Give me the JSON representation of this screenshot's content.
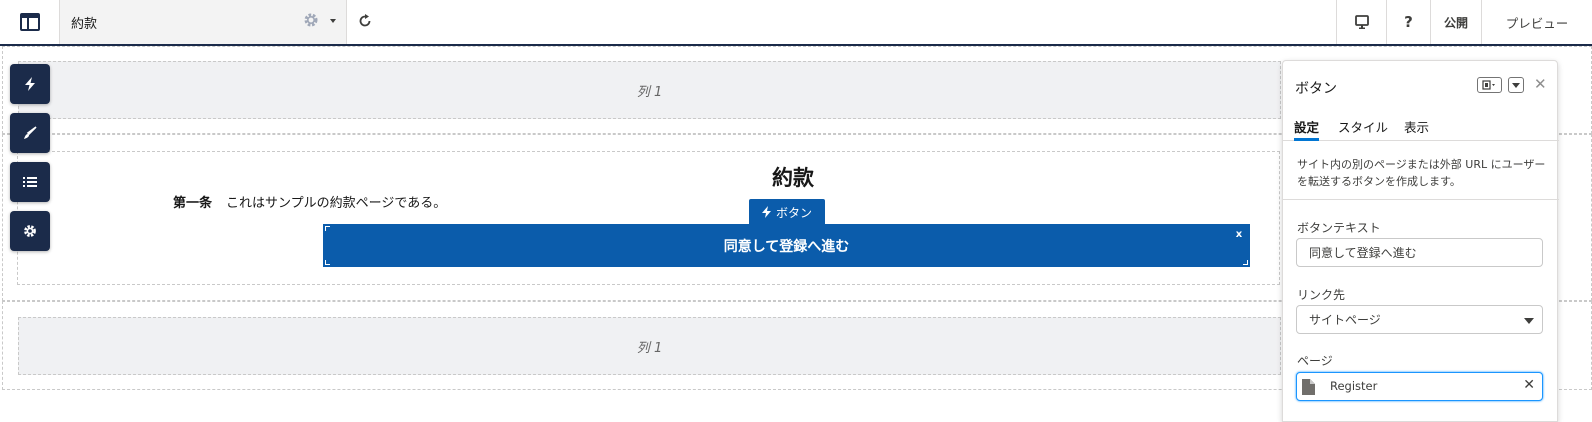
{
  "header": {
    "page_name": "約款",
    "publish_label": "公開",
    "preview_label": "プレビュー",
    "help_label": "?"
  },
  "canvas": {
    "column_label_top": "列",
    "column_number_top": "1",
    "column_label_bottom": "列",
    "column_number_bottom": "1",
    "title": "約款",
    "article_label": "第一条",
    "article_text": "これはサンプルの約款ページである。",
    "button_tag_label": "ボタン",
    "button_text": "同意して登録へ進む",
    "button_close": "x"
  },
  "panel": {
    "title": "ボタン",
    "tabs": [
      {
        "label": "設定",
        "active": true
      },
      {
        "label": "スタイル",
        "active": false
      },
      {
        "label": "表示",
        "active": false
      }
    ],
    "description": "サイト内の別のページまたは外部 URL にユーザーを転送するボタンを作成します。",
    "button_text_label": "ボタンテキスト",
    "button_text_value": "同意して登録へ進む",
    "link_label": "リンク先",
    "link_value": "サイトページ",
    "page_label": "ページ",
    "page_value": "Register"
  },
  "colors": {
    "navy": "#1b2b4a",
    "brand_blue": "#0b5cab",
    "active_tab": "#0176d3"
  }
}
